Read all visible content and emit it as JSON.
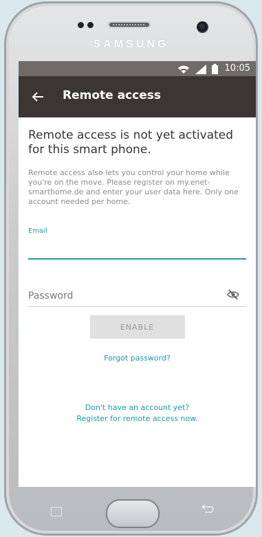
{
  "device": {
    "brand": "SAMSUNG"
  },
  "status_bar": {
    "time": "10:05",
    "icons": [
      "wifi-icon",
      "signal-icon",
      "battery-icon"
    ]
  },
  "app_bar": {
    "back_icon": "arrow-left-icon",
    "title": "Remote access"
  },
  "content": {
    "headline": "Remote access is not yet activated for this smart phone.",
    "description": "Remote access also lets you control your home while you're on the move. Please register on my.enet-smarthome.de and enter your user data here. Only one account needed per home.",
    "email": {
      "label": "Email",
      "value": ""
    },
    "password": {
      "placeholder": "Password",
      "toggle_icon": "eye-off-icon"
    },
    "enable_button": "ENABLE",
    "forgot_password": "Forgot password?",
    "no_account": "Don't have an account yet?",
    "register_link": "Register for remote access now."
  },
  "colors": {
    "accent": "#1a9aa8",
    "app_bar": "#3b3633",
    "status_bar": "#6e6b69"
  }
}
